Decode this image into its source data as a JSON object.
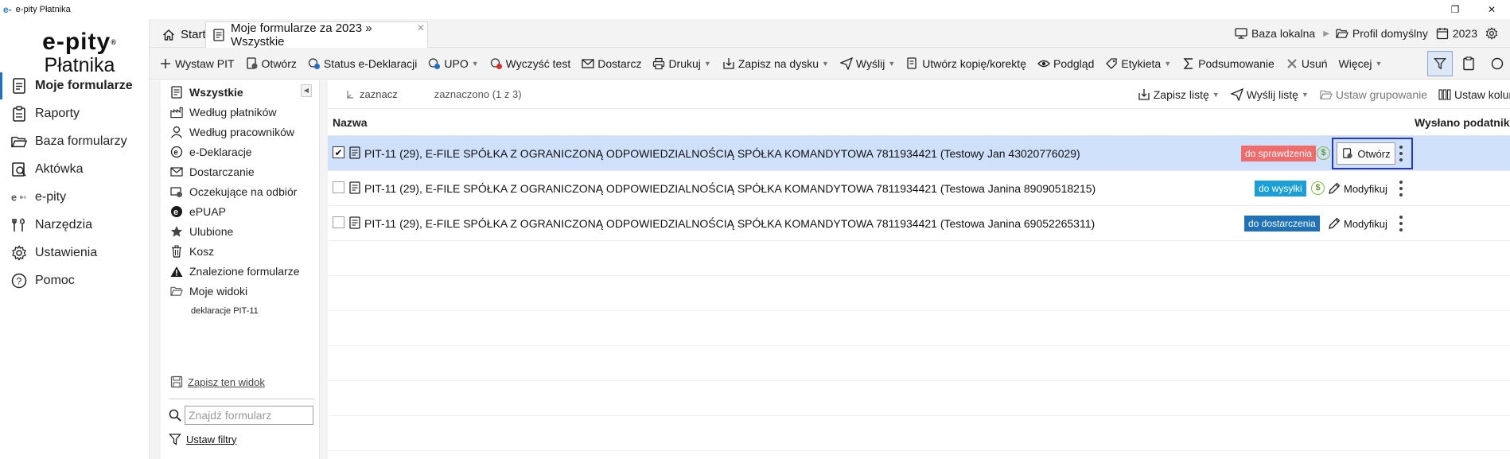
{
  "window": {
    "app_logo": "e-",
    "title": "e-pity Płatnika",
    "restore_glyph": "❐",
    "close_glyph": "✕"
  },
  "brand": {
    "line1": "e-pity",
    "reg": "®",
    "line2": "Płatnika"
  },
  "nav": {
    "items": [
      {
        "label": "Moje formularze",
        "icon": "document-icon"
      },
      {
        "label": "Raporty",
        "icon": "clipboard-icon"
      },
      {
        "label": "Baza formularzy",
        "icon": "folder-open-icon"
      },
      {
        "label": "Aktówka",
        "icon": "briefcase-icon"
      },
      {
        "label": "e-pity",
        "icon": "epity-logo-icon"
      },
      {
        "label": "Narzędzia",
        "icon": "tools-icon"
      },
      {
        "label": "Ustawienia",
        "icon": "gear-icon"
      },
      {
        "label": "Pomoc",
        "icon": "help-icon"
      }
    ]
  },
  "tabs": [
    {
      "label": "Start",
      "icon": "home-icon"
    },
    {
      "label": "Moje formularze za 2023 » Wszystkie",
      "icon": "document-icon"
    }
  ],
  "tab_close_glyph": "✕",
  "header_right": {
    "database": "Baza lokalna",
    "profile": "Profil domyślny",
    "year": "2023",
    "separator": "▶"
  },
  "toolbar": {
    "buttons": [
      {
        "label": "Wystaw PIT",
        "icon": "plus-icon",
        "caret": false
      },
      {
        "label": "Otwórz",
        "icon": "open-doc-icon",
        "caret": false
      },
      {
        "label": "Status e-Deklaracji",
        "icon": "status-icon",
        "caret": false
      },
      {
        "label": "UPO",
        "icon": "upo-icon",
        "caret": true
      },
      {
        "label": "Wyczyść test",
        "icon": "clear-test-icon",
        "caret": false
      },
      {
        "label": "Dostarcz",
        "icon": "envelope-icon",
        "caret": false
      },
      {
        "label": "Drukuj",
        "icon": "printer-icon",
        "caret": true
      },
      {
        "label": "Zapisz na dysku",
        "icon": "save-disk-icon",
        "caret": true
      },
      {
        "label": "Wyślij",
        "icon": "send-icon",
        "caret": true
      },
      {
        "label": "Utwórz kopię/korektę",
        "icon": "copy-icon",
        "caret": false
      },
      {
        "label": "Podgląd",
        "icon": "eye-icon",
        "caret": false
      },
      {
        "label": "Etykieta",
        "icon": "tag-icon",
        "caret": true
      },
      {
        "label": "Podsumowanie",
        "icon": "sigma-icon",
        "caret": false
      },
      {
        "label": "Usuń",
        "icon": "delete-x-icon",
        "caret": false
      },
      {
        "label": "Więcej",
        "icon": "",
        "caret": true
      }
    ],
    "caret_glyph": "▼"
  },
  "folders": {
    "items": [
      {
        "label": "Wszystkie",
        "icon": "document-icon"
      },
      {
        "label": "Według płatników",
        "icon": "factory-icon"
      },
      {
        "label": "Według pracowników",
        "icon": "person-icon"
      },
      {
        "label": "e-Deklaracje",
        "icon": "edeklaracje-icon"
      },
      {
        "label": "Dostarczanie",
        "icon": "envelope-icon"
      },
      {
        "label": "Oczekujące na odbiór",
        "icon": "pending-icon"
      },
      {
        "label": "ePUAP",
        "icon": "epuap-icon"
      },
      {
        "label": "Ulubione",
        "icon": "star-icon"
      },
      {
        "label": "Kosz",
        "icon": "trash-icon"
      },
      {
        "label": "Znalezione formularze",
        "icon": "warning-icon"
      },
      {
        "label": "Moje widoki",
        "icon": "folder-open-icon"
      }
    ],
    "subitems": [
      {
        "label": "deklaracje PIT-11"
      }
    ],
    "collapse_glyph": "◀",
    "save_view": "Zapisz ten widok",
    "search_placeholder": "Znajdź formularz",
    "set_filters": "Ustaw filtry"
  },
  "list_tools": {
    "select": "zaznacz",
    "selected_count": "zaznaczono (1 z 3)",
    "save_list": "Zapisz listę",
    "send_list": "Wyślij listę",
    "set_grouping": "Ustaw grupowanie",
    "set_columns": "Ustaw kolumny"
  },
  "columns": {
    "name": "Nazwa",
    "sent": "Wysłano podatnikowi"
  },
  "check_glyph": "✔",
  "dollar_glyph": "$",
  "rows": [
    {
      "text": "PIT-11 (29), E-FILE SPÓŁKA Z OGRANICZONĄ ODPOWIEDZIALNOŚCIĄ SPÓŁKA KOMANDYTOWA 7811934421 (Testowy Jan 43020776029)",
      "status": "do sprawdzenia",
      "status_color": "#f06b6b",
      "action": "Otwórz",
      "checked": true
    },
    {
      "text": "PIT-11 (29), E-FILE SPÓŁKA Z OGRANICZONĄ ODPOWIEDZIALNOŚCIĄ SPÓŁKA KOMANDYTOWA 7811934421 (Testowa Janina 89090518215)",
      "status": "do wysyłki",
      "status_color": "#1a9fd9",
      "action": "Modyfikuj",
      "checked": false
    },
    {
      "text": "PIT-11 (29), E-FILE SPÓŁKA Z OGRANICZONĄ ODPOWIEDZIALNOŚCIĄ SPÓŁKA KOMANDYTOWA 7811934421 (Testowa Janina 69052265311)",
      "status": "do dostarczenia",
      "status_color": "#1f72b8",
      "action": "Modyfikuj",
      "checked": false
    }
  ],
  "colors": {
    "accent": "#1e6fc8",
    "selected_row": "#cfe0fb",
    "highlight_frame": "#2437c9"
  }
}
